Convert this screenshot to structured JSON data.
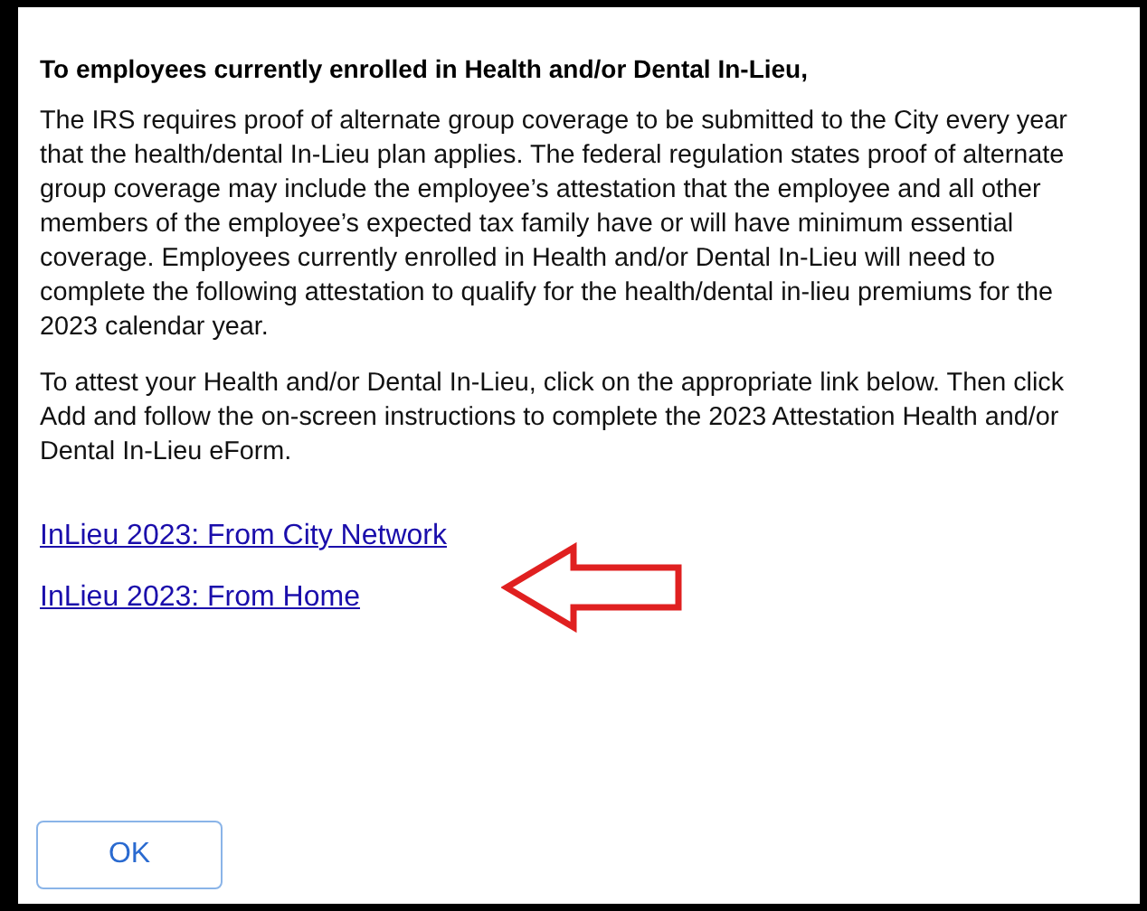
{
  "heading": "To employees currently enrolled in Health and/or Dental In-Lieu,",
  "paragraphs": [
    "The IRS requires proof of alternate group coverage to be submitted to the City every year that the health/dental In-Lieu plan applies. The federal regulation states proof of alternate group coverage may include the employee’s attestation that the employee and all other members of the employee’s expected tax family have or will have minimum essential coverage. Employees currently enrolled in Health and/or Dental In-Lieu will need to complete the following attestation to qualify for the health/dental in-lieu premiums for the 2023 calendar year.",
    "To attest your Health and/or Dental In-Lieu, click on the appropriate link below. Then click Add and follow the on-screen instructions to complete the 2023 Attestation Health and/or Dental In-Lieu eForm."
  ],
  "links": [
    "InLieu 2023: From City Network",
    "InLieu 2023: From Home"
  ],
  "buttons": [
    "OK"
  ]
}
